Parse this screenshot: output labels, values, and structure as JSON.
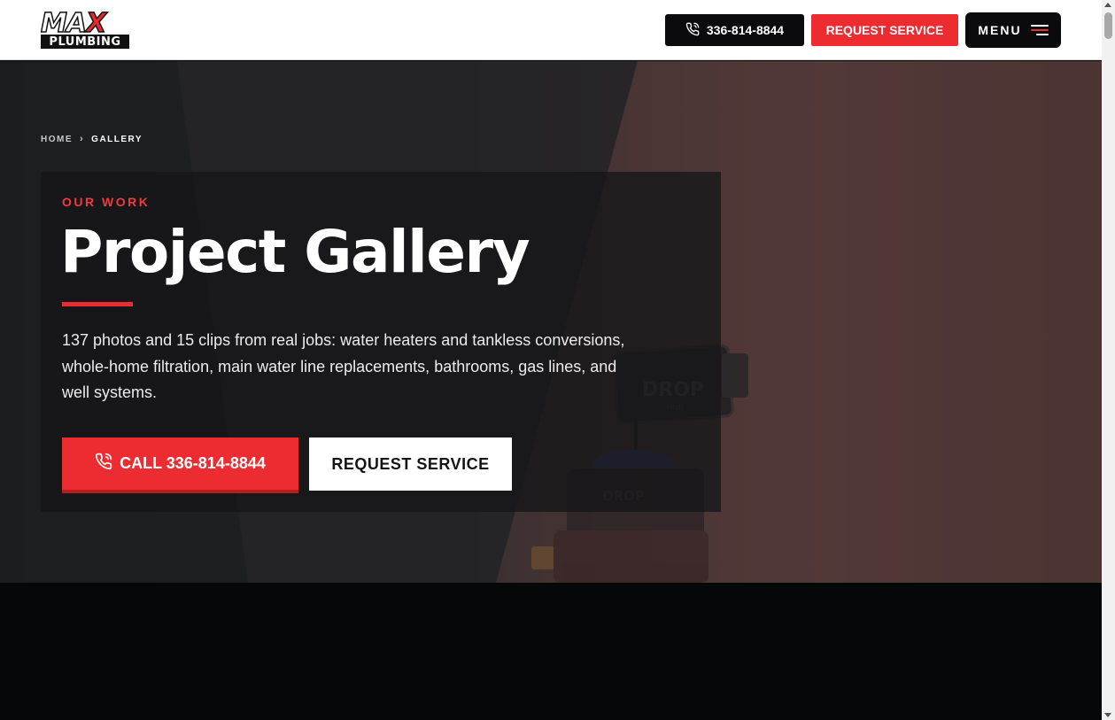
{
  "header": {
    "logo": {
      "line1_a": "MA",
      "line1_b": "X",
      "line2": "PLUMBING"
    },
    "phone_label": "336-814-8844",
    "request_label": "REQUEST SERVICE",
    "menu_label": "MENU"
  },
  "breadcrumb": {
    "home": "HOME",
    "separator": "›",
    "current": "GALLERY"
  },
  "hero": {
    "eyebrow": "OUR WORK",
    "title": "Project Gallery",
    "description": "137 photos and 15 clips from real jobs: water heaters and tankless conversions, whole-home filtration, main water line replacements, bathrooms, gas lines, and well systems.",
    "call_label": "CALL 336-814-8844",
    "request_label": "REQUEST SERVICE",
    "image_text": {
      "hub_brand": "DROP",
      "hub_sub": "Hub",
      "valve_brand": "DROP"
    }
  },
  "colors": {
    "accent": "#ec2c31",
    "dark": "#0b0b0d",
    "white": "#ffffff"
  },
  "icons": {
    "phone": "phone-icon",
    "menu": "hamburger-menu-icon"
  }
}
